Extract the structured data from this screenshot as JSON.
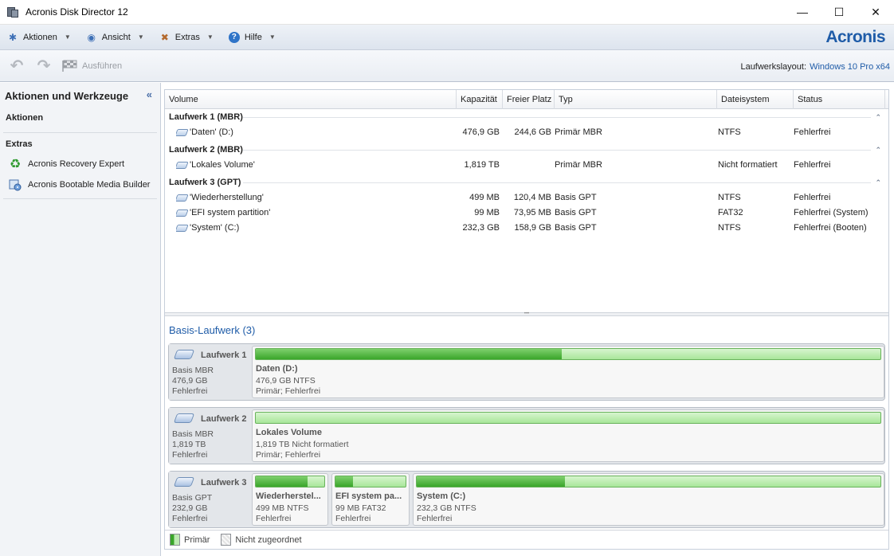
{
  "window": {
    "title": "Acronis Disk Director 12"
  },
  "menu": {
    "items": [
      {
        "label": "Aktionen"
      },
      {
        "label": "Ansicht"
      },
      {
        "label": "Extras"
      },
      {
        "label": "Hilfe"
      }
    ],
    "brand": "Acronis"
  },
  "toolbar": {
    "execute_label": "Ausführen",
    "layout_label": "Laufwerkslayout:",
    "layout_value": "Windows 10 Pro x64"
  },
  "leftpanel": {
    "title": "Aktionen und Werkzeuge",
    "section_actions": "Aktionen",
    "section_extras": "Extras",
    "extras": [
      {
        "label": "Acronis Recovery Expert"
      },
      {
        "label": "Acronis Bootable Media Builder"
      }
    ]
  },
  "grid": {
    "columns": [
      "Volume",
      "Kapazität",
      "Freier Platz",
      "Typ",
      "Dateisystem",
      "Status"
    ],
    "groups": [
      {
        "title": "Laufwerk 1 (MBR)",
        "volumes": [
          {
            "name": "'Daten' (D:)",
            "capacity": "476,9 GB",
            "free": "244,6 GB",
            "type": "Primär MBR",
            "fs": "NTFS",
            "status": "Fehlerfrei"
          }
        ]
      },
      {
        "title": "Laufwerk 2 (MBR)",
        "volumes": [
          {
            "name": "'Lokales Volume'",
            "capacity": "1,819 TB",
            "free": "",
            "type": "Primär MBR",
            "fs": "Nicht formatiert",
            "status": "Fehlerfrei"
          }
        ]
      },
      {
        "title": "Laufwerk 3 (GPT)",
        "volumes": [
          {
            "name": "'Wiederherstellung'",
            "capacity": "499 MB",
            "free": "120,4 MB",
            "type": "Basis GPT",
            "fs": "NTFS",
            "status": "Fehlerfrei"
          },
          {
            "name": "'EFI system partition'",
            "capacity": "99 MB",
            "free": "73,95 MB",
            "type": "Basis GPT",
            "fs": "FAT32",
            "status": "Fehlerfrei (System)"
          },
          {
            "name": "'System' (C:)",
            "capacity": "232,3 GB",
            "free": "158,9 GB",
            "type": "Basis GPT",
            "fs": "NTFS",
            "status": "Fehlerfrei (Booten)"
          }
        ]
      }
    ]
  },
  "disks": {
    "title": "Basis-Laufwerk (3)",
    "items": [
      {
        "name": "Laufwerk 1",
        "style": "Basis MBR",
        "size": "476,9 GB",
        "status": "Fehlerfrei",
        "partitions": [
          {
            "name": "Daten (D:)",
            "info": "476,9 GB NTFS",
            "state": "Primär; Fehlerfrei",
            "used": 0.49
          }
        ]
      },
      {
        "name": "Laufwerk 2",
        "style": "Basis MBR",
        "size": "1,819 TB",
        "status": "Fehlerfrei",
        "partitions": [
          {
            "name": "Lokales Volume",
            "info": "1,819 TB Nicht formatiert",
            "state": "Primär; Fehlerfrei",
            "used": 0
          }
        ]
      },
      {
        "name": "Laufwerk 3",
        "style": "Basis GPT",
        "size": "232,9 GB",
        "status": "Fehlerfrei",
        "partitions": [
          {
            "name": "Wiederherstel...",
            "info": "499 MB NTFS",
            "state": "Fehlerfrei",
            "used": 0.76
          },
          {
            "name": "EFI system pa...",
            "info": "99 MB FAT32",
            "state": "Fehlerfrei",
            "used": 0.25
          },
          {
            "name": "System (C:)",
            "info": "232,3 GB NTFS",
            "state": "Fehlerfrei",
            "used": 0.32
          }
        ]
      }
    ]
  },
  "legend": {
    "primary": "Primär",
    "unallocated": "Nicht zugeordnet"
  }
}
